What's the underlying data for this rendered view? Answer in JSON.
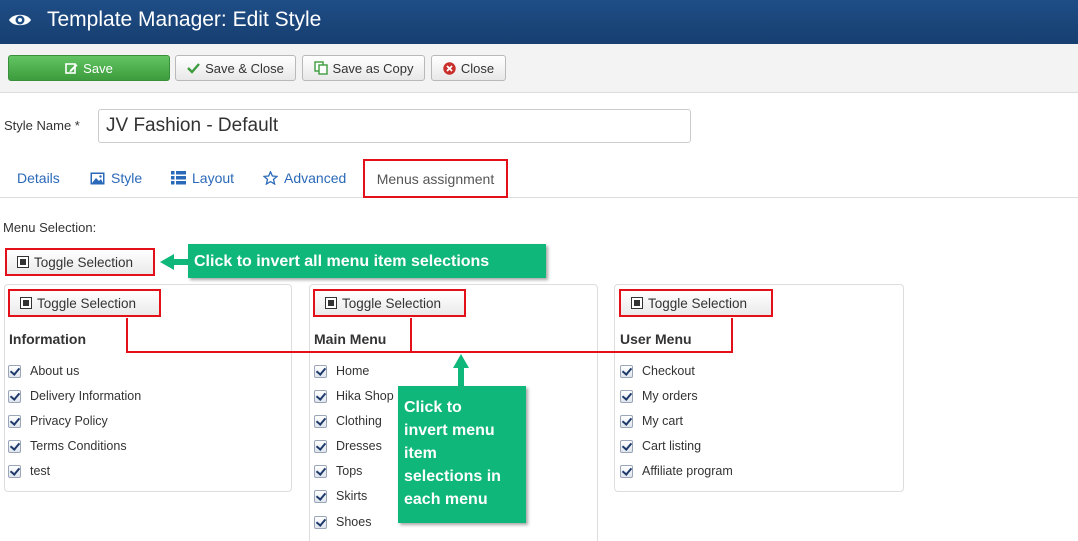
{
  "header": {
    "title": "Template Manager: Edit Style",
    "icon": "eye-icon"
  },
  "toolbar": {
    "save_label": "Save",
    "save_close_label": "Save & Close",
    "save_copy_label": "Save as Copy",
    "close_label": "Close"
  },
  "form": {
    "style_name_label": "Style Name *",
    "style_name_value": "JV Fashion - Default"
  },
  "tabs": [
    {
      "label": "Details"
    },
    {
      "label": "Style"
    },
    {
      "label": "Layout"
    },
    {
      "label": "Advanced"
    },
    {
      "label": "Menus assignment"
    }
  ],
  "menu_selection": {
    "label": "Menu Selection:",
    "toggle_all_label": "Toggle Selection",
    "menus": [
      {
        "title": "Information",
        "toggle_label": "Toggle Selection",
        "items": [
          "About us",
          "Delivery Information",
          "Privacy Policy",
          "Terms Conditions",
          "test"
        ]
      },
      {
        "title": "Main Menu",
        "toggle_label": "Toggle Selection",
        "items": [
          "Home",
          "Hika Shop",
          "Clothing",
          "Dresses",
          "Tops",
          "Skirts",
          "Shoes"
        ]
      },
      {
        "title": "User Menu",
        "toggle_label": "Toggle Selection",
        "items": [
          "Checkout",
          "My orders",
          "My cart",
          "Cart listing",
          "Affiliate program"
        ]
      }
    ]
  },
  "annotations": {
    "callout_all": "Click to invert all menu item selections",
    "callout_each_lines": [
      "Click to",
      "invert menu",
      "item",
      "selections in",
      "each menu"
    ]
  },
  "colors": {
    "header": "#1e4d86",
    "save": "#4cae4c",
    "highlight": "#e3101a",
    "callout": "#0fb77a",
    "link": "#2a69b8"
  }
}
